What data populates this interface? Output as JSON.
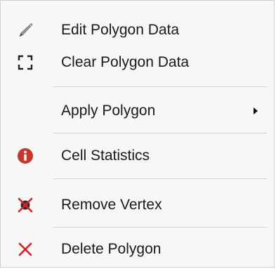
{
  "menu": {
    "items": [
      {
        "label": "Edit Polygon Data",
        "icon": "pencil-icon"
      },
      {
        "label": "Clear Polygon Data",
        "icon": "dashed-corners-icon"
      },
      {
        "label": "Apply Polygon",
        "icon": "",
        "has_submenu": true
      },
      {
        "label": "Cell Statistics",
        "icon": "info-icon"
      },
      {
        "label": "Remove Vertex",
        "icon": "remove-vertex-icon"
      },
      {
        "label": "Delete Polygon",
        "icon": "delete-x-icon"
      }
    ]
  },
  "colors": {
    "info_red": "#c8352b",
    "delete_red": "#e21b1b",
    "menu_bg": "#f7f7f7",
    "separator": "#d4d4d4"
  }
}
